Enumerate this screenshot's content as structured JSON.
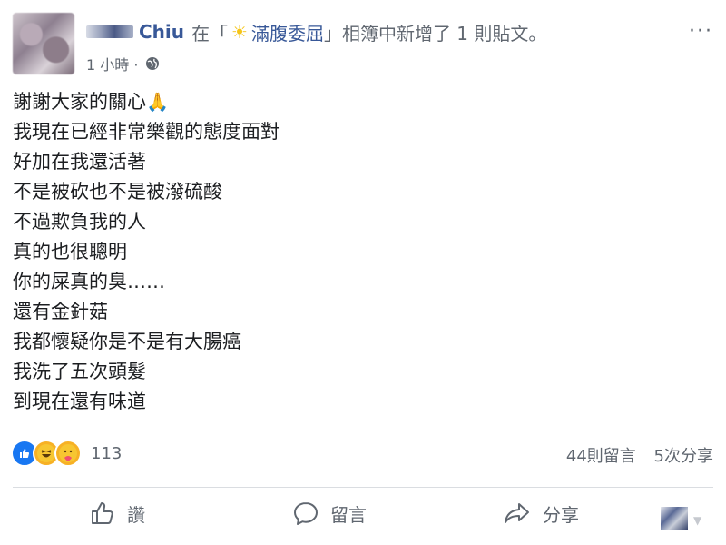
{
  "post": {
    "author": "Chiu",
    "prefix": "在「",
    "album": "滿腹委屈",
    "suffix": "」相簿中新增了 1 則貼文。",
    "time": "1 小時 ·",
    "more": "···",
    "lines": [
      "謝謝大家的關心",
      "我現在已經非常樂觀的態度面對",
      "好加在我還活著",
      "不是被砍也不是被潑硫酸",
      "不過欺負我的人",
      "真的也很聰明",
      "你的屎真的臭……",
      "還有金針菇",
      "我都懷疑你是不是有大腸癌",
      "我洗了五次頭髮",
      "到現在還有味道"
    ],
    "pray_emoji": "🙏",
    "sun_emoji": "☀"
  },
  "stats": {
    "reaction_count": "113",
    "comments": "44則留言",
    "shares": "5次分享"
  },
  "actions": {
    "like": "讚",
    "comment": "留言",
    "share": "分享",
    "caret": "▼"
  },
  "icons": [
    "globe-icon",
    "sun-icon",
    "like-reaction-icon",
    "haha-reaction-icon",
    "care-reaction-icon",
    "thumbs-up-icon",
    "comment-icon",
    "share-icon"
  ],
  "colors": {
    "link": "#385898",
    "meta": "#606770",
    "like_blue": "#1877f2",
    "divider": "#dadde1"
  }
}
